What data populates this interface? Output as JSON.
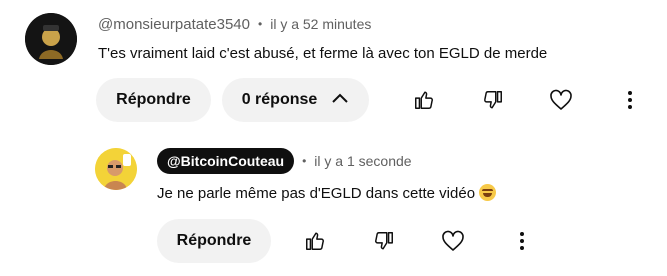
{
  "comment": {
    "author": "@monsieurpatate3540",
    "separator": "•",
    "time": "il y a 52 minutes",
    "text": "T'es vraiment laid c'est abusé, et ferme là avec ton EGLD de merde",
    "reply_label": "Répondre",
    "replies_label": "0 réponse",
    "icons": [
      "thumbs-up-icon",
      "thumbs-down-icon",
      "heart-icon",
      "more-vert-icon",
      "chevron-up-icon"
    ]
  },
  "reply": {
    "author": "@BitcoinCouteau",
    "separator": "•",
    "time": "il y a 1 seconde",
    "text": "Je ne parle même pas d'EGLD dans cette vidéo",
    "emoji": "laughing-tears-emoji",
    "reply_label": "Répondre",
    "icons": [
      "thumbs-up-icon",
      "thumbs-down-icon",
      "heart-icon",
      "more-vert-icon"
    ]
  },
  "colors": {
    "text": "#0f0f0f",
    "secondary": "#606060",
    "pill_bg": "#f2f2f2",
    "chip_bg": "#0f0f0f"
  }
}
